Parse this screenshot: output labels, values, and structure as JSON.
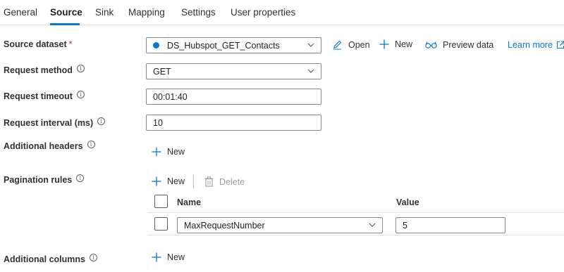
{
  "tabs": [
    "General",
    "Source",
    "Sink",
    "Mapping",
    "Settings",
    "User properties"
  ],
  "active_tab": "Source",
  "source_dataset": {
    "label": "Source dataset",
    "required_marker": "*",
    "value": "DS_Hubspot_GET_Contacts",
    "open_label": "Open",
    "new_label": "New",
    "preview_label": "Preview data",
    "learn_more_label": "Learn more"
  },
  "request_method": {
    "label": "Request method",
    "value": "GET"
  },
  "request_timeout": {
    "label": "Request timeout",
    "value": "00:01:40"
  },
  "request_interval": {
    "label": "Request interval (ms)",
    "value": "10"
  },
  "additional_headers": {
    "label": "Additional headers",
    "new_label": "New"
  },
  "pagination": {
    "label": "Pagination rules",
    "new_label": "New",
    "delete_label": "Delete",
    "columns": {
      "name": "Name",
      "value": "Value"
    },
    "rows": [
      {
        "name": "MaxRequestNumber",
        "value": "5"
      }
    ]
  },
  "additional_columns": {
    "label": "Additional columns",
    "new_label": "New"
  },
  "colors": {
    "accent": "#0078d4",
    "text": "#323130",
    "border": "#8a8886",
    "required": "#a4262c"
  }
}
